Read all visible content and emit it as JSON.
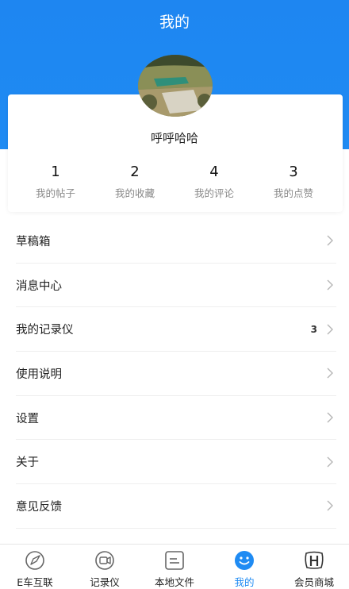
{
  "header": {
    "title": "我的"
  },
  "profile": {
    "username": "呼呼哈哈"
  },
  "stats": [
    {
      "value": "1",
      "label": "我的帖子"
    },
    {
      "value": "2",
      "label": "我的收藏"
    },
    {
      "value": "4",
      "label": "我的评论"
    },
    {
      "value": "3",
      "label": "我的点赞"
    }
  ],
  "menu": [
    {
      "label": "草稿箱",
      "badge": ""
    },
    {
      "label": "消息中心",
      "badge": ""
    },
    {
      "label": "我的记录仪",
      "badge": "3"
    },
    {
      "label": "使用说明",
      "badge": ""
    },
    {
      "label": "设置",
      "badge": ""
    },
    {
      "label": "关于",
      "badge": ""
    },
    {
      "label": "意见反馈",
      "badge": ""
    }
  ],
  "tabbar": [
    {
      "label": "E车互联",
      "icon": "compass-icon",
      "active": false
    },
    {
      "label": "记录仪",
      "icon": "camera-icon",
      "active": false
    },
    {
      "label": "本地文件",
      "icon": "file-icon",
      "active": false
    },
    {
      "label": "我的",
      "icon": "smile-icon",
      "active": true
    },
    {
      "label": "会员商城",
      "icon": "honda-logo-icon",
      "active": false
    }
  ],
  "colors": {
    "accent": "#1f8bf3",
    "text": "#222222",
    "muted": "#888888"
  }
}
